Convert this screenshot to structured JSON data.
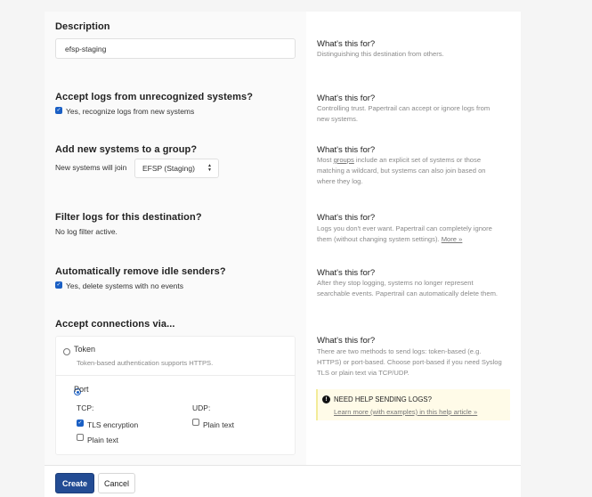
{
  "description": {
    "heading": "Description",
    "value": "efsp-staging",
    "help_title": "What's this for?",
    "help_text": "Distinguishing this destination from others."
  },
  "accept_logs": {
    "heading": "Accept logs from unrecognized systems?",
    "checkbox_label": "Yes, recognize logs from new systems",
    "checked": true,
    "help_title": "What's this for?",
    "help_line1": "Controlling trust. Papertrail can accept or ignore logs from",
    "help_line2": "new systems."
  },
  "group": {
    "heading": "Add new systems to a group?",
    "label": "New systems will join",
    "selected": "EFSP (Staging)",
    "help_title": "What's this for?",
    "help_line1_pre": "Most ",
    "help_line1_link": "groups",
    "help_line1_post": " include an explicit set of systems or those",
    "help_line2": "matching a wildcard, but systems can also join based on",
    "help_line3": "where they log."
  },
  "filter": {
    "heading": "Filter logs for this destination?",
    "status": "No log filter active.",
    "help_title": "What's this for?",
    "help_line1": "Logs you don't ever want. Papertrail can completely ignore",
    "help_line2": "them (without changing system settings).",
    "help_more": "More »"
  },
  "idle": {
    "heading": "Automatically remove idle senders?",
    "checkbox_label": "Yes, delete systems with no events",
    "checked": true,
    "help_title": "What's this for?",
    "help_line1": "After they stop logging, systems no longer represent",
    "help_line2": "searchable events. Papertrail can automatically delete them."
  },
  "connections": {
    "heading": "Accept connections via...",
    "token_label": "Token",
    "token_desc": "Token-based authentication supports HTTPS.",
    "port_label": "Port",
    "tcp_label": "TCP:",
    "udp_label": "UDP:",
    "tls_label": "TLS encryption",
    "tcp_plain_label": "Plain text",
    "udp_plain_label": "Plain text",
    "help_title": "What's this for?",
    "help_line1": "There are two methods to send logs: token-based (e.g.",
    "help_line2": "HTTPS) or port-based. Choose port-based if you need Syslog",
    "help_line3": "TLS or plain text via TCP/UDP."
  },
  "notice": {
    "title": "NEED HELP SENDING LOGS?",
    "link": "Learn more (with examples) in this help article »"
  },
  "footer": {
    "create_label": "Create",
    "cancel_label": "Cancel"
  },
  "colors": {
    "accent": "#1a5fc4",
    "primary_button": "#234c94",
    "notice_bg": "#fffbe8"
  }
}
